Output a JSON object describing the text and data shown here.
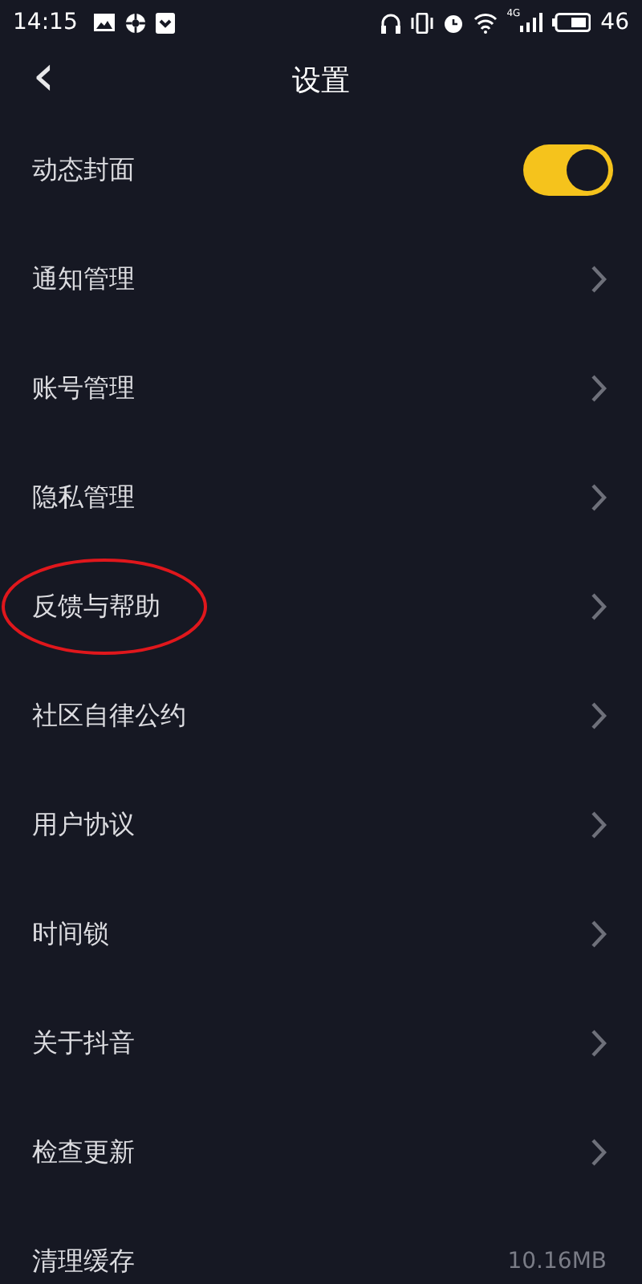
{
  "status_bar": {
    "time": "14:15",
    "network_type": "4G",
    "battery": "46"
  },
  "header": {
    "back": "‹",
    "title": "设置"
  },
  "items": [
    {
      "kind": "toggle",
      "label": "动态封面",
      "on": true,
      "circled": false
    },
    {
      "kind": "link",
      "label": "通知管理",
      "circled": false
    },
    {
      "kind": "link",
      "label": "账号管理",
      "circled": false
    },
    {
      "kind": "link",
      "label": "隐私管理",
      "circled": false
    },
    {
      "kind": "link",
      "label": "反馈与帮助",
      "circled": true
    },
    {
      "kind": "link",
      "label": "社区自律公约",
      "circled": false
    },
    {
      "kind": "link",
      "label": "用户协议",
      "circled": false
    },
    {
      "kind": "link",
      "label": "时间锁",
      "circled": false
    },
    {
      "kind": "link",
      "label": "关于抖音",
      "circled": false
    },
    {
      "kind": "link",
      "label": "检查更新",
      "circled": false
    },
    {
      "kind": "value",
      "label": "清理缓存",
      "value": "10.16MB",
      "circled": false
    }
  ]
}
